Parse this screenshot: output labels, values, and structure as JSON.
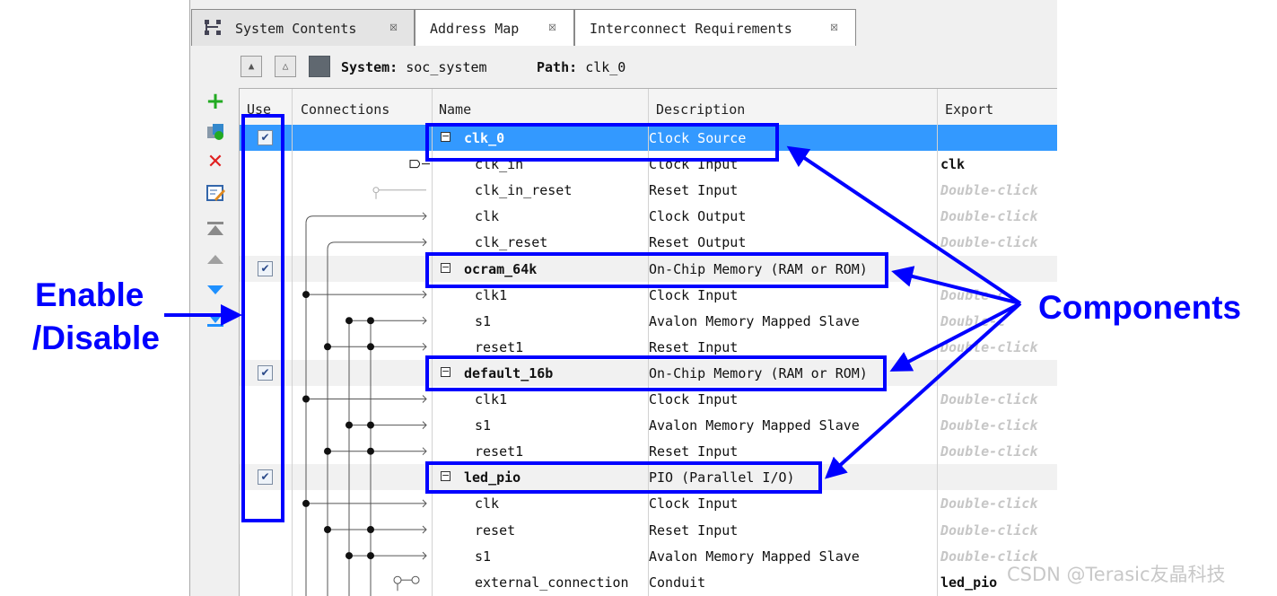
{
  "tabs": [
    {
      "label": "System Contents",
      "close": "☒"
    },
    {
      "label": "Address Map",
      "close": "☒"
    },
    {
      "label": "Interconnect Requirements",
      "close": "☒"
    }
  ],
  "pathbar": {
    "system_label": "System:",
    "system_value": "soc_system",
    "path_label": "Path:",
    "path_value": "clk_0"
  },
  "toolbar_icons": [
    "add-icon",
    "add-component-icon",
    "remove-icon",
    "edit-icon",
    "move-top-icon",
    "move-up-icon",
    "move-down-icon",
    "move-bottom-icon"
  ],
  "columns": {
    "use": "Use",
    "connections": "Connections",
    "name": "Name",
    "description": "Description",
    "export": "Export"
  },
  "rows": [
    {
      "type": "group",
      "name": "clk_0",
      "description": "Clock Source",
      "export": "",
      "checked": true,
      "selected": true
    },
    {
      "type": "child",
      "name": "clk_in",
      "description": "Clock Input",
      "export": "clk",
      "export_style": "value"
    },
    {
      "type": "child",
      "name": "clk_in_reset",
      "description": "Reset Input",
      "export": "Double-click",
      "export_style": "hint"
    },
    {
      "type": "child",
      "name": "clk",
      "description": "Clock Output",
      "export": "Double-click",
      "export_style": "hint"
    },
    {
      "type": "child",
      "name": "clk_reset",
      "description": "Reset Output",
      "export": "Double-click",
      "export_style": "hint"
    },
    {
      "type": "group",
      "name": "ocram_64k",
      "description": "On-Chip Memory (RAM or ROM)",
      "export": "",
      "checked": true
    },
    {
      "type": "child",
      "name": "clk1",
      "description": "Clock Input",
      "export": "Double-c",
      "export_style": "hint"
    },
    {
      "type": "child",
      "name": "s1",
      "description": "Avalon Memory Mapped Slave",
      "export": "Double-c",
      "export_style": "hint"
    },
    {
      "type": "child",
      "name": "reset1",
      "description": "Reset Input",
      "export": "Double-click",
      "export_style": "hint"
    },
    {
      "type": "group",
      "name": "default_16b",
      "description": "On-Chip Memory (RAM or ROM)",
      "export": "",
      "checked": true
    },
    {
      "type": "child",
      "name": "clk1",
      "description": "Clock Input",
      "export": "Double-click",
      "export_style": "hint"
    },
    {
      "type": "child",
      "name": "s1",
      "description": "Avalon Memory Mapped Slave",
      "export": "Double-click",
      "export_style": "hint"
    },
    {
      "type": "child",
      "name": "reset1",
      "description": "Reset Input",
      "export": "Double-click",
      "export_style": "hint"
    },
    {
      "type": "group",
      "name": "led_pio",
      "description": "PIO (Parallel I/O)",
      "export": "",
      "checked": true
    },
    {
      "type": "child",
      "name": "clk",
      "description": "Clock Input",
      "export": "Double-click",
      "export_style": "hint"
    },
    {
      "type": "child",
      "name": "reset",
      "description": "Reset Input",
      "export": "Double-click",
      "export_style": "hint"
    },
    {
      "type": "child",
      "name": "s1",
      "description": "Avalon Memory Mapped Slave",
      "export": "Double-click",
      "export_style": "hint"
    },
    {
      "type": "child",
      "name": "external_connection",
      "description": "Conduit",
      "export": "led_pio",
      "export_style": "value"
    }
  ],
  "annotations": {
    "enable_line1": "Enable",
    "enable_line2": "/Disable",
    "components": "Components",
    "color": "#0000ff"
  },
  "watermark": "CSDN @Terasic友晶科技",
  "colors": {
    "selection": "#3399ff",
    "hint_text": "#c6c6c6",
    "group_row": "#f1f1f1"
  }
}
